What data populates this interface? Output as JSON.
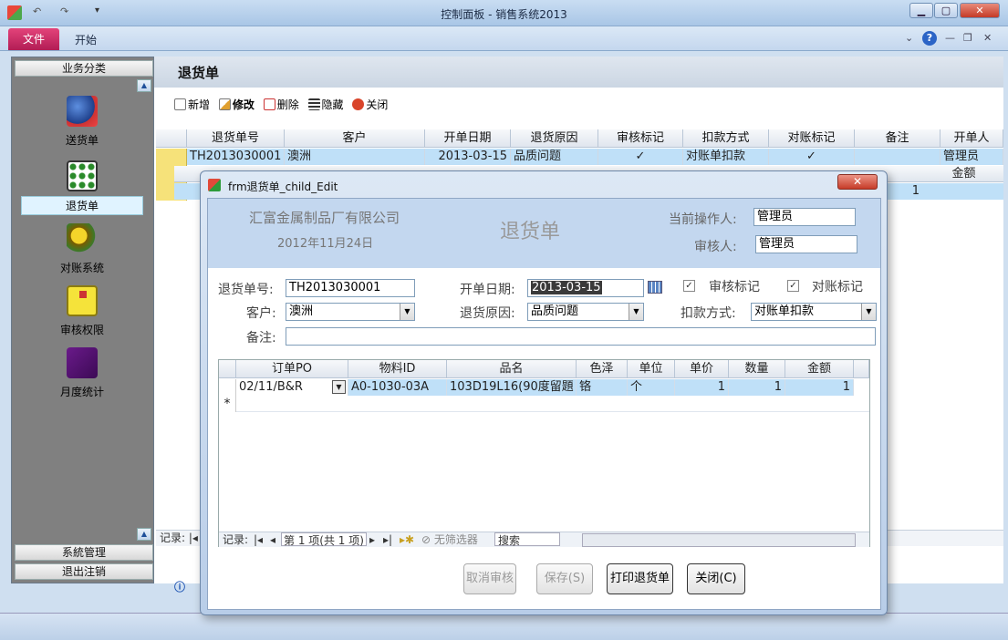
{
  "window": {
    "title": "控制面板 - 销售系统2013"
  },
  "ribbon": {
    "file_tab": "文件",
    "start_tab": "开始",
    "help": "?"
  },
  "nav": {
    "header": "业务分类",
    "items": [
      {
        "label": "送货单"
      },
      {
        "label": "退货单"
      },
      {
        "label": "对账系统"
      },
      {
        "label": "审核权限"
      },
      {
        "label": "月度统计"
      }
    ],
    "bottom_groups": [
      "系統管理",
      "退出注销"
    ]
  },
  "main": {
    "title": "退货单",
    "toolbar": {
      "add": "新增",
      "edit": "修改",
      "delete": "删除",
      "hide": "隐藏",
      "close": "关闭"
    },
    "columns": [
      "退货单号",
      "客户",
      "开单日期",
      "退货原因",
      "审核标记",
      "扣款方式",
      "对账标记",
      "备注",
      "开单人"
    ],
    "row": {
      "order_no": "TH2013030001",
      "customer": "澳洲",
      "date": "2013-03-15",
      "reason": "品质问题",
      "audit": "✓",
      "deduction": "对账单扣款",
      "recon": "✓",
      "note": "",
      "creator": "管理员"
    },
    "child_col_last": "金额",
    "child_value": "1",
    "record_label": "记录:"
  },
  "dialog": {
    "title": "frm退货单_child_Edit",
    "close_symbol": "✕",
    "company": "汇富金属制品厂有限公司",
    "form_date": "2012年11月24日",
    "heading": "退货单",
    "operator_label": "当前操作人:",
    "operator_value": "管理员",
    "auditor_label": "审核人:",
    "auditor_value": "管理员",
    "order_no_label": "退货单号:",
    "order_no_value": "TH2013030001",
    "date_label": "开单日期:",
    "date_value": "2013-03-15",
    "audit_label": "审核标记",
    "recon_label": "对账标记",
    "customer_label": "客户:",
    "customer_value": "澳洲",
    "reason_label": "退货原因:",
    "reason_value": "品质问题",
    "deduction_label": "扣款方式:",
    "deduction_value": "对账单扣款",
    "note_label": "备注:",
    "note_value": "",
    "sub_columns": [
      "订单PO",
      "物料ID",
      "品名",
      "色泽",
      "单位",
      "单价",
      "数量",
      "金额"
    ],
    "sub_row": {
      "po": "02/11/B&R",
      "material": "A0-1030-03A",
      "name": "103D19L16(90度留題",
      "color": "铬",
      "unit": "个",
      "price": "1",
      "qty": "1",
      "amount": "1"
    },
    "new_row_marker": "*",
    "nav_record": "记录:",
    "nav_position": "第 1 项(共 1 项)",
    "nav_filter": "无筛选器",
    "nav_search": "搜索",
    "buttons": {
      "cancel_audit": "取消审核",
      "save": "保存(S)",
      "print": "打印退货单",
      "close": "关闭(C)"
    }
  },
  "colors": {
    "accent": "#b21d55",
    "selection": "#bfe0f8",
    "header_band": "#c3d7ef"
  }
}
